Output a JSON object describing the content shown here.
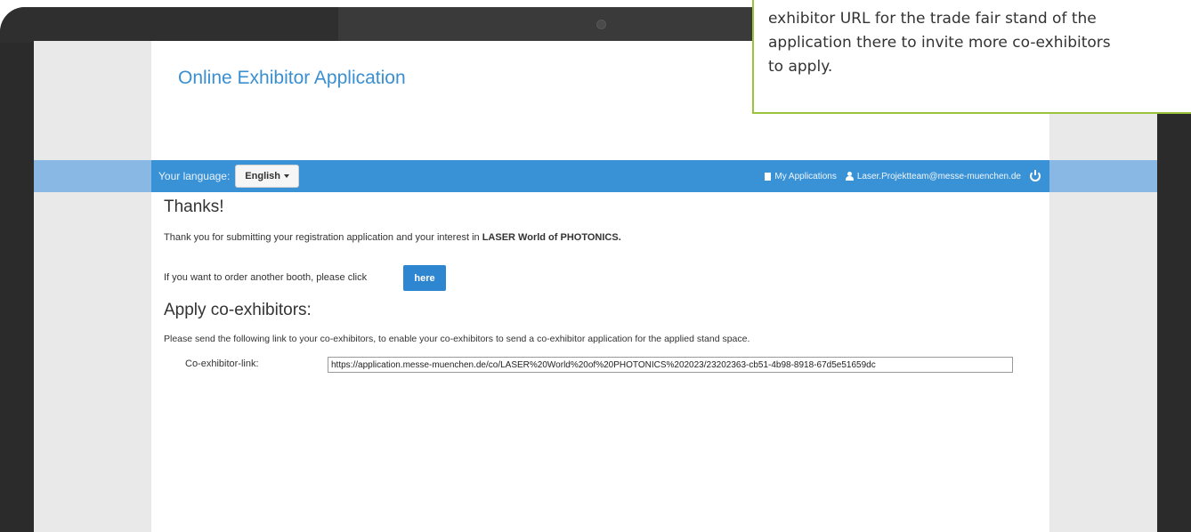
{
  "app": {
    "title": "Online Exhibitor Application"
  },
  "navbar": {
    "language_label": "Your language:",
    "language_value": "English",
    "my_applications": "My Applications",
    "user_email": "Laser.Projektteam@messe-muenchen.de"
  },
  "thanks": {
    "title": "Thanks!",
    "text_prefix": "Thank you for submitting your registration application and your interest in ",
    "event_name": "LASER World of PHOTONICS.",
    "another_booth_text": "If you want to order another booth, please click",
    "here_button": "here"
  },
  "co_exhibitors": {
    "title": "Apply co-exhibitors:",
    "instructions": "Please send the following link to your co-exhibitors, to enable your co-exhibitors to send a co-exhibitor application for the applied stand space.",
    "link_label": "Co-exhibitor-link:",
    "link_value": "https://application.messe-muenchen.de/co/LASER%20World%20of%20PHOTONICS%202023/23202363-cb51-4b98-8918-67d5e51659dc"
  },
  "callout": {
    "line1": "exhibitor URL for the trade fair stand of the",
    "line2": "application there to invite more co-exhibitors",
    "line3": "to apply."
  },
  "colors": {
    "navbar": "#3a92d6",
    "navbar_outer": "#88b8e3",
    "title": "#3a8fd1",
    "button": "#2e86d0",
    "callout_border": "#9cc43a"
  }
}
